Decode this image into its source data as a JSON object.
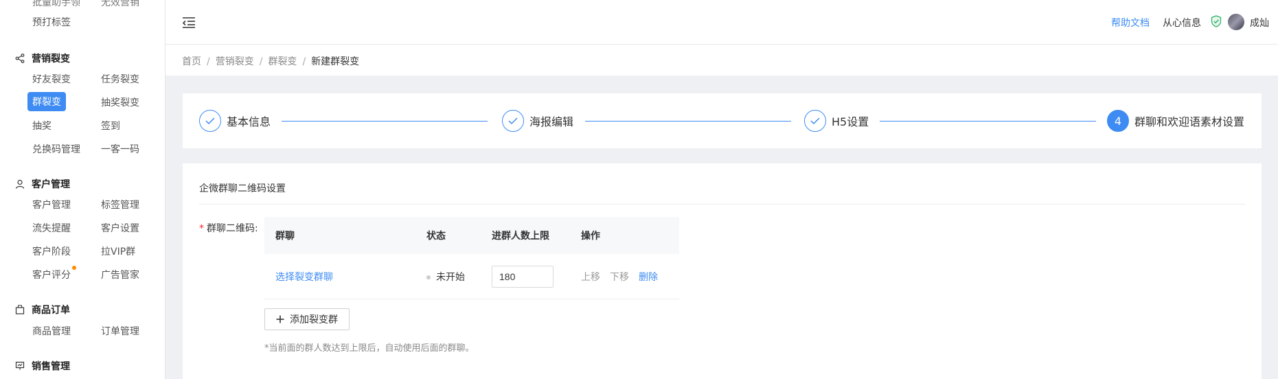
{
  "sidebar": {
    "top_item": "预打标签",
    "sections": [
      {
        "title": "营销裂变",
        "items": [
          "好友裂变",
          "任务裂变",
          "群裂变",
          "抽奖裂变",
          "抽奖",
          "签到",
          "兑换码管理",
          "一客一码"
        ]
      },
      {
        "title": "客户管理",
        "items": [
          "客户管理",
          "标签管理",
          "流失提醒",
          "客户设置",
          "客户阶段",
          "拉VIP群",
          "客户评分",
          "广告管家"
        ]
      },
      {
        "title": "商品订单",
        "items": [
          "商品管理",
          "订单管理"
        ]
      },
      {
        "title": "销售管理",
        "items": []
      }
    ],
    "active_item": "群裂变",
    "accent_color": "#3d8bf3"
  },
  "header": {
    "help_label": "帮助文档",
    "org_name": "从心信息",
    "user_name": "成灿"
  },
  "breadcrumb": [
    "首页",
    "营销裂变",
    "群裂变",
    "新建群裂变"
  ],
  "steps": [
    {
      "label": "基本信息",
      "state": "done"
    },
    {
      "label": "海报编辑",
      "state": "done"
    },
    {
      "label": "H5设置",
      "state": "done"
    },
    {
      "label": "群聊和欢迎语素材设置",
      "state": "active",
      "number": "4"
    }
  ],
  "form": {
    "section_title": "企微群聊二维码设置",
    "field_label": "群聊二维码:",
    "table": {
      "headers": [
        "群聊",
        "状态",
        "进群人数上限",
        "操作"
      ],
      "rows": [
        {
          "group": "选择裂变群聊",
          "status": "未开始",
          "limit": "180",
          "ops": [
            "上移",
            "下移",
            "删除"
          ]
        }
      ]
    },
    "add_button": "添加裂变群",
    "hint": "*当前面的群人数达到上限后，自动使用后面的群聊。"
  }
}
